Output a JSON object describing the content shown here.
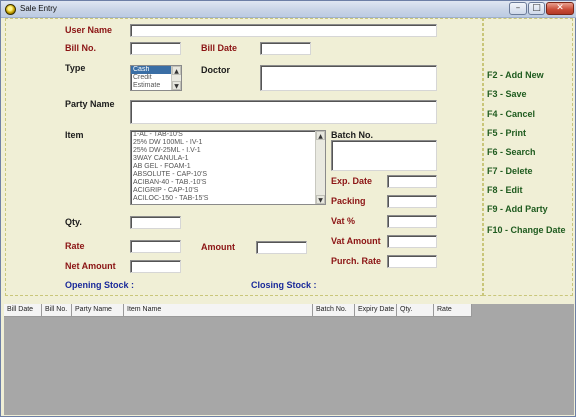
{
  "window": {
    "title": "Sale Entry"
  },
  "controls": {
    "minimize": "–",
    "maximize": "□",
    "close": "✕"
  },
  "form": {
    "user_name_label": "User Name",
    "bill_no_label": "Bill No.",
    "bill_date_label": "Bill Date",
    "type_label": "Type",
    "type_options": [
      "Cash",
      "Credit",
      "Estimate"
    ],
    "doctor_label": "Doctor",
    "party_name_label": "Party Name",
    "item_label": "Item",
    "items": [
      "1-AL - TAB-10'S",
      "25% DW 100ML - IV-1",
      "25% DW-25ML - I.V-1",
      "3WAY CANULA-1",
      "AB GEL - FOAM-1",
      "ABSOLUTE - CAP-10'S",
      "ACIBAN-40 - TAB.-10'S",
      "ACIGRIP - CAP-10'S",
      "ACILOC-150 - TAB-15'S"
    ],
    "batch_no_label": "Batch No.",
    "exp_date_label": "Exp. Date",
    "packing_label": "Packing",
    "vat_pct_label": "Vat %",
    "vat_amount_label": "Vat Amount",
    "purch_rate_label": "Purch. Rate",
    "qty_label": "Qty.",
    "rate_label": "Rate",
    "amount_label": "Amount",
    "net_amount_label": "Net Amount",
    "opening_stock_label": "Opening Stock :",
    "closing_stock_label": "Closing Stock :"
  },
  "shortcuts": [
    "F2 - Add New",
    "F3 - Save",
    "F4 - Cancel",
    "F5 - Print",
    "F6 - Search",
    "F7 - Delete",
    "F8 - Edit",
    "F9 - Add Party",
    "F10 - Change Date"
  ],
  "grid": {
    "columns": [
      "Bill Date",
      "Bill No.",
      "Party Name",
      "Item Name",
      "Batch No.",
      "Expiry Date",
      "Qty.",
      "Rate"
    ]
  },
  "colors": {
    "label_red": "#8b1414",
    "label_blue": "#1a2a9a",
    "label_green": "#1f5b1f",
    "selection": "#3a6ea5"
  }
}
